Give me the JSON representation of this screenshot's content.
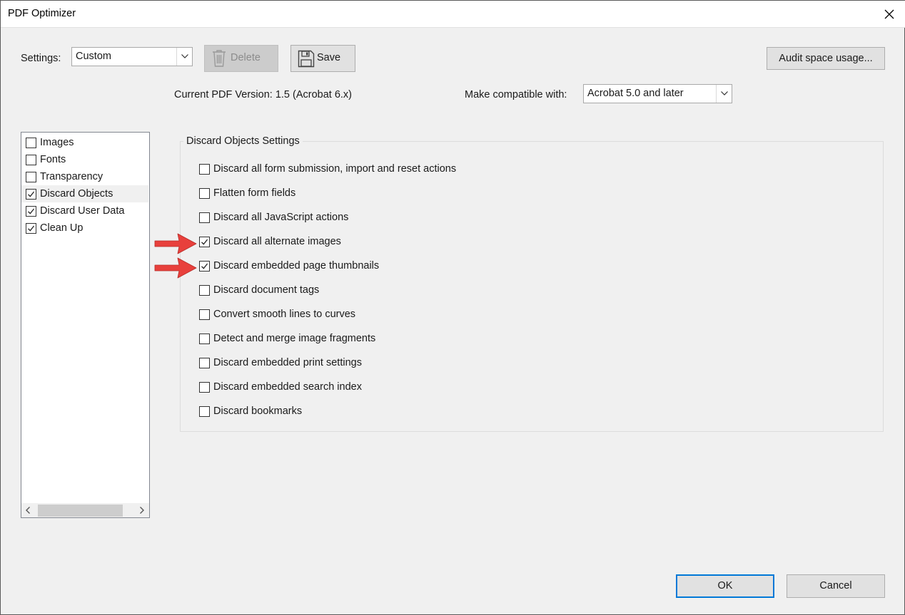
{
  "window": {
    "title": "PDF Optimizer"
  },
  "settings": {
    "label": "Settings:",
    "value": "Custom",
    "delete_label": "Delete",
    "save_label": "Save",
    "audit_label": "Audit space usage..."
  },
  "version": {
    "current": "Current PDF Version: 1.5 (Acrobat 6.x)",
    "compat_label": "Make compatible with:",
    "compat_value": "Acrobat 5.0 and later"
  },
  "panels": [
    {
      "label": "Images",
      "checked": false,
      "selected": false
    },
    {
      "label": "Fonts",
      "checked": false,
      "selected": false
    },
    {
      "label": "Transparency",
      "checked": false,
      "selected": false
    },
    {
      "label": "Discard Objects",
      "checked": true,
      "selected": true
    },
    {
      "label": "Discard User Data",
      "checked": true,
      "selected": false
    },
    {
      "label": "Clean Up",
      "checked": true,
      "selected": false
    }
  ],
  "discard_objects": {
    "title": "Discard Objects Settings",
    "options": [
      {
        "label": "Discard all form submission, import and reset actions",
        "checked": false,
        "highlighted": false
      },
      {
        "label": "Flatten form fields",
        "checked": false,
        "highlighted": false
      },
      {
        "label": "Discard all JavaScript actions",
        "checked": false,
        "highlighted": false
      },
      {
        "label": "Discard all alternate images",
        "checked": true,
        "highlighted": true
      },
      {
        "label": "Discard embedded page thumbnails",
        "checked": true,
        "highlighted": true
      },
      {
        "label": "Discard document tags",
        "checked": false,
        "highlighted": false
      },
      {
        "label": "Convert smooth lines to curves",
        "checked": false,
        "highlighted": false
      },
      {
        "label": "Detect and merge image fragments",
        "checked": false,
        "highlighted": false
      },
      {
        "label": "Discard embedded print settings",
        "checked": false,
        "highlighted": false
      },
      {
        "label": "Discard embedded search index",
        "checked": false,
        "highlighted": false
      },
      {
        "label": "Discard bookmarks",
        "checked": false,
        "highlighted": false
      }
    ]
  },
  "footer": {
    "ok_label": "OK",
    "cancel_label": "Cancel"
  },
  "colors": {
    "accent": "#0078d7",
    "arrow": "#e8403c"
  },
  "icons": [
    "close-icon",
    "chevron-down-icon",
    "trash-icon",
    "floppy-disk-icon",
    "checkmark-icon",
    "chevron-left-icon",
    "chevron-right-icon",
    "red-arrow-icon"
  ]
}
